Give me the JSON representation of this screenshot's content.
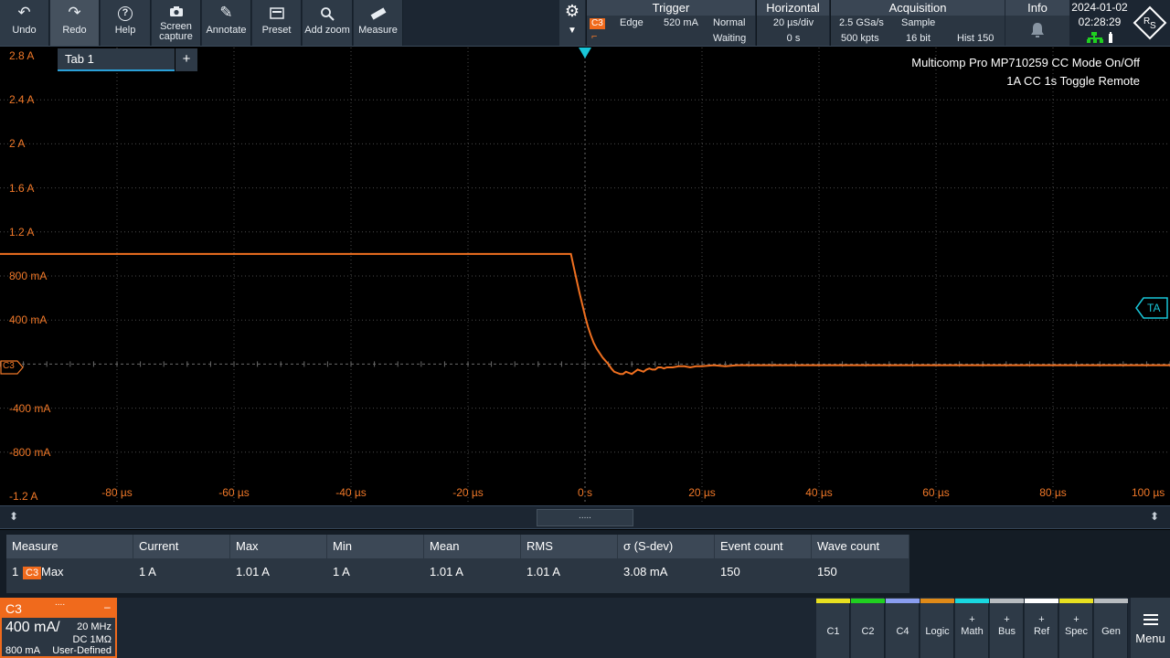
{
  "toolbar": {
    "buttons": [
      {
        "label": "Undo",
        "icon": "undo-icon",
        "glyph": "↶"
      },
      {
        "label": "Redo",
        "icon": "redo-icon",
        "glyph": "↷"
      },
      {
        "label": "Help",
        "icon": "help-icon",
        "glyph": "?"
      },
      {
        "label": "Screen",
        "label2": "capture",
        "icon": "camera-icon",
        "glyph": "📷"
      },
      {
        "label": "Annotate",
        "icon": "pencil-icon",
        "glyph": "✎"
      },
      {
        "label": "Preset",
        "icon": "preset-icon",
        "glyph": "▭"
      },
      {
        "label": "Add zoom",
        "icon": "zoom-icon",
        "glyph": "🔍"
      },
      {
        "label": "Measure",
        "icon": "ruler-icon",
        "glyph": "📏"
      }
    ]
  },
  "trigger": {
    "title": "Trigger",
    "channel": "C3",
    "type": "Edge",
    "level": "520 mA",
    "mode": "Normal",
    "state": "Waiting"
  },
  "horizontal": {
    "title": "Horizontal",
    "scale": "20 µs/div",
    "position": "0 s"
  },
  "acquisition": {
    "title": "Acquisition",
    "rate": "2.5 GSa/s",
    "mode": "Sample",
    "points": "500 kpts",
    "resolution": "16 bit",
    "history": "Hist 150"
  },
  "info": {
    "title": "Info"
  },
  "datetime": {
    "date": "2024-01-02",
    "time": "02:28:29"
  },
  "tabs": {
    "tab1": "Tab 1",
    "add": "+"
  },
  "annotation": {
    "line1": "Multicomp Pro MP710259 CC Mode On/Off",
    "line2": "1A CC 1s Toggle Remote"
  },
  "markers": {
    "ta": "TA",
    "c3": "C3"
  },
  "colors": {
    "trace": "#f07020",
    "c3": "#f06a1c",
    "cyan": "#19c6d8",
    "grid": "#555555"
  },
  "chart_data": {
    "type": "line",
    "title": "Multicomp Pro MP710259 CC Mode On/Off",
    "subtitle": "1A CC 1s Toggle Remote",
    "xlabel": "",
    "ylabel": "",
    "xlim": [
      -100,
      100
    ],
    "ylim": [
      -1.2,
      2.8
    ],
    "x_unit": "µs",
    "y_unit": "A",
    "y_ticks": [
      "2.8 A",
      "2.4 A",
      "2 A",
      "1.6 A",
      "1.2 A",
      "800 mA",
      "400 mA",
      "0 A",
      "-400 mA",
      "-800 mA",
      "-1.2 A"
    ],
    "y_tick_values": [
      2.8,
      2.4,
      2.0,
      1.6,
      1.2,
      0.8,
      0.4,
      0,
      -0.4,
      -0.8,
      -1.2
    ],
    "x_ticks": [
      "-80 µs",
      "-60 µs",
      "-40 µs",
      "-20 µs",
      "0 s",
      "20 µs",
      "40 µs",
      "60 µs",
      "80 µs",
      "100 µs"
    ],
    "x_tick_values": [
      -80,
      -60,
      -40,
      -20,
      0,
      20,
      40,
      60,
      80,
      100
    ],
    "grid": true,
    "series": [
      {
        "name": "C3",
        "x": [
          -100,
          -2.4,
          -2.0,
          -1.5,
          -1.0,
          -0.5,
          0,
          0.5,
          1.0,
          1.5,
          2.0,
          2.5,
          3.0,
          3.5,
          4.0,
          4.5,
          5.0,
          5.5,
          6.0,
          6.5,
          7.0,
          7.5,
          8.0,
          8.5,
          9.0,
          9.5,
          10.0,
          10.5,
          11.0,
          11.5,
          12.0,
          12.5,
          13.0,
          13.5,
          14.0,
          15.0,
          16.0,
          17.0,
          18.0,
          19.0,
          20.0,
          22.0,
          24.0,
          26.0,
          30.0,
          40.0,
          60.0,
          80.0,
          100.0
        ],
        "y": [
          1.0,
          1.0,
          0.9,
          0.78,
          0.66,
          0.55,
          0.44,
          0.34,
          0.26,
          0.19,
          0.14,
          0.1,
          0.06,
          0.03,
          0.0,
          -0.04,
          -0.07,
          -0.08,
          -0.09,
          -0.09,
          -0.07,
          -0.08,
          -0.09,
          -0.07,
          -0.05,
          -0.06,
          -0.07,
          -0.05,
          -0.04,
          -0.05,
          -0.05,
          -0.03,
          -0.03,
          -0.04,
          -0.03,
          -0.03,
          -0.02,
          -0.02,
          -0.03,
          -0.02,
          -0.02,
          -0.01,
          -0.02,
          -0.01,
          -0.01,
          -0.01,
          -0.01,
          -0.01,
          -0.01
        ]
      }
    ]
  },
  "measure": {
    "headers": [
      "Measure",
      "Current",
      "Max",
      "Min",
      "Mean",
      "RMS",
      "σ (S-dev)",
      "Event count",
      "Wave count"
    ],
    "row": {
      "index": "1",
      "channel": "C3",
      "type": "Max",
      "current": "1 A",
      "max": "1.01 A",
      "min": "1 A",
      "mean": "1.01 A",
      "rms": "1.01 A",
      "sdev": "3.08 mA",
      "event_count": "150",
      "wave_count": "150"
    }
  },
  "channel_box": {
    "name": "C3",
    "scale": "400 mA/",
    "bandwidth": "20 MHz",
    "coupling": "DC 1MΩ",
    "offset": "800 mA",
    "probe": "User-Defined"
  },
  "signal_buttons": [
    {
      "label": "C1",
      "plus": "",
      "color": "#e8e020"
    },
    {
      "label": "C2",
      "plus": "",
      "color": "#20d020"
    },
    {
      "label": "C4",
      "plus": "",
      "color": "#8a9ef0"
    },
    {
      "label": "Logic",
      "plus": "",
      "color": "#e08a18"
    },
    {
      "label": "Math",
      "plus": "+",
      "color": "#19d8e0"
    },
    {
      "label": "Bus",
      "plus": "+",
      "color": "#b8bcc0"
    },
    {
      "label": "Ref",
      "plus": "+",
      "color": "#ffffff"
    },
    {
      "label": "Spec",
      "plus": "+",
      "color": "#e8e020"
    },
    {
      "label": "Gen",
      "plus": "",
      "color": "#b8bcc0"
    }
  ],
  "menu_label": "Menu",
  "splitter_handle": "....."
}
